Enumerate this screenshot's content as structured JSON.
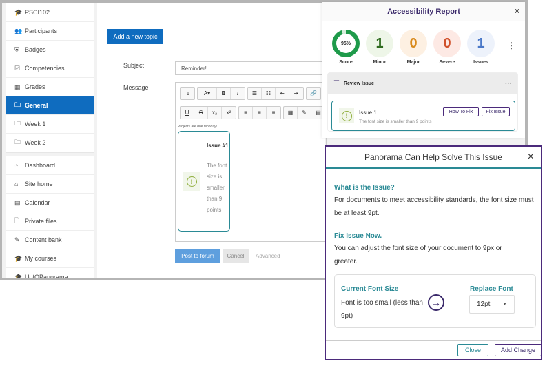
{
  "sidebar": {
    "course_items": [
      {
        "label": "PSCI102",
        "icon": "graduation-cap-icon",
        "glyph": "🎓"
      },
      {
        "label": "Participants",
        "icon": "users-icon",
        "glyph": "👥"
      },
      {
        "label": "Badges",
        "icon": "shield-icon",
        "glyph": "⛨"
      },
      {
        "label": "Competencies",
        "icon": "checkbox-icon",
        "glyph": "☑"
      },
      {
        "label": "Grades",
        "icon": "table-icon",
        "glyph": "▦"
      },
      {
        "label": "General",
        "icon": "folder-icon",
        "glyph": "🗀",
        "active": true
      },
      {
        "label": "Week 1",
        "icon": "folder-icon",
        "glyph": "🗀"
      },
      {
        "label": "Week 2",
        "icon": "folder-icon",
        "glyph": "🗀"
      }
    ],
    "site_items": [
      {
        "label": "Dashboard",
        "icon": "dashboard-icon",
        "glyph": "◔"
      },
      {
        "label": "Site home",
        "icon": "home-icon",
        "glyph": "⌂"
      },
      {
        "label": "Calendar",
        "icon": "calendar-icon",
        "glyph": "▤"
      },
      {
        "label": "Private files",
        "icon": "file-icon",
        "glyph": "🗋"
      },
      {
        "label": "Content bank",
        "icon": "brush-icon",
        "glyph": "✎"
      },
      {
        "label": "My courses",
        "icon": "graduation-cap-icon",
        "glyph": "🎓"
      },
      {
        "label": "UofOPanorama",
        "icon": "graduation-cap-icon",
        "glyph": "🎓"
      }
    ]
  },
  "main": {
    "add_topic": "Add a new topic",
    "subject_label": "Subject",
    "subject_value": "Reminder!",
    "message_label": "Message",
    "editor_text": "Projects are due Monday!",
    "popup_title": "Issue #1",
    "popup_desc": "The font size is smaller than 9 points",
    "post": "Post to forum",
    "cancel": "Cancel",
    "advanced": "Advanced"
  },
  "report": {
    "title": "Accessibility Report",
    "close": "×",
    "score": {
      "value": "95%",
      "label": "Score",
      "percent": 95,
      "color": "#1e9a4a"
    },
    "stats": [
      {
        "value": "1",
        "label": "Minor",
        "color": "#2f6b1f",
        "bg": "#eef6e8"
      },
      {
        "value": "0",
        "label": "Major",
        "color": "#d98a1c",
        "bg": "#fdf0e2"
      },
      {
        "value": "0",
        "label": "Severe",
        "color": "#d0502a",
        "bg": "#fde9e4"
      },
      {
        "value": "1",
        "label": "Issues",
        "color": "#4a78c8",
        "bg": "#edf2fb"
      }
    ],
    "review_title": "Review Issue",
    "issue_title": "Issue 1",
    "issue_desc": "The font size is smaller than 9 points",
    "how_to_fix": "How To Fix",
    "fix_issue": "Fix Issue"
  },
  "modal": {
    "title": "Panorama Can Help Solve This Issue",
    "close": "×",
    "what_heading": "What is the Issue?",
    "what_text": "For documents to meet accessibility standards, the font size must be at least 9pt.",
    "fix_heading": "Fix Issue Now.",
    "fix_text": "You can adjust the font size of your document to 9px or greater.",
    "current_heading": "Current Font Size",
    "current_text": "Font is too small (less than 9pt)",
    "replace_heading": "Replace Font",
    "replace_value": "12pt",
    "close_btn": "Close",
    "add_change": "Add Change"
  },
  "colors": {
    "accent": "#0f6cbf",
    "teal": "#2a8a95",
    "purple": "#4b2a7b"
  }
}
